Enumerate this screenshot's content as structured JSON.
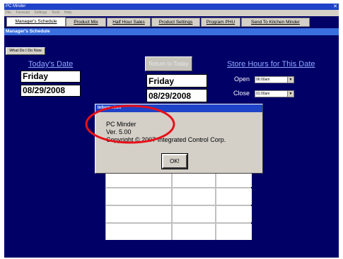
{
  "window": {
    "title": "PC Minder",
    "close_glyph": "✕",
    "menu": [
      "File",
      "Forecast",
      "Settings",
      "Tools",
      "Help"
    ]
  },
  "tabs": [
    {
      "label": "Manager's Schedule",
      "active": true
    },
    {
      "label": "Product Mix"
    },
    {
      "label": "Half Hour Sales"
    },
    {
      "label": "Product Settings"
    },
    {
      "label": "Program PHU"
    },
    {
      "label": "Send To Kitchen Minder"
    }
  ],
  "section_title": "Manager's Schedule",
  "what_do_button": "What Do I Do Now",
  "today": {
    "heading": "Today's Date",
    "day": "Friday",
    "date": "08/29/2008"
  },
  "return_button": "Return to Today",
  "selected": {
    "day": "Friday",
    "date": "08/29/2008"
  },
  "store_hours": {
    "heading": "Store Hours for This Date",
    "open_label": "Open",
    "open_value": "06:00am",
    "close_label": "Close",
    "close_value": "01:00am"
  },
  "dialog": {
    "title": "Information",
    "line1": "PC Minder",
    "line2": "Ver. 5.00",
    "line3": "Copyright © 2007 Integrated Control Corp.",
    "ok": "OK!"
  },
  "colors": {
    "background": "#000066",
    "titlebar": "#1f43c8",
    "section_bar": "#3a6fe0",
    "annotation": "#e8101a"
  }
}
